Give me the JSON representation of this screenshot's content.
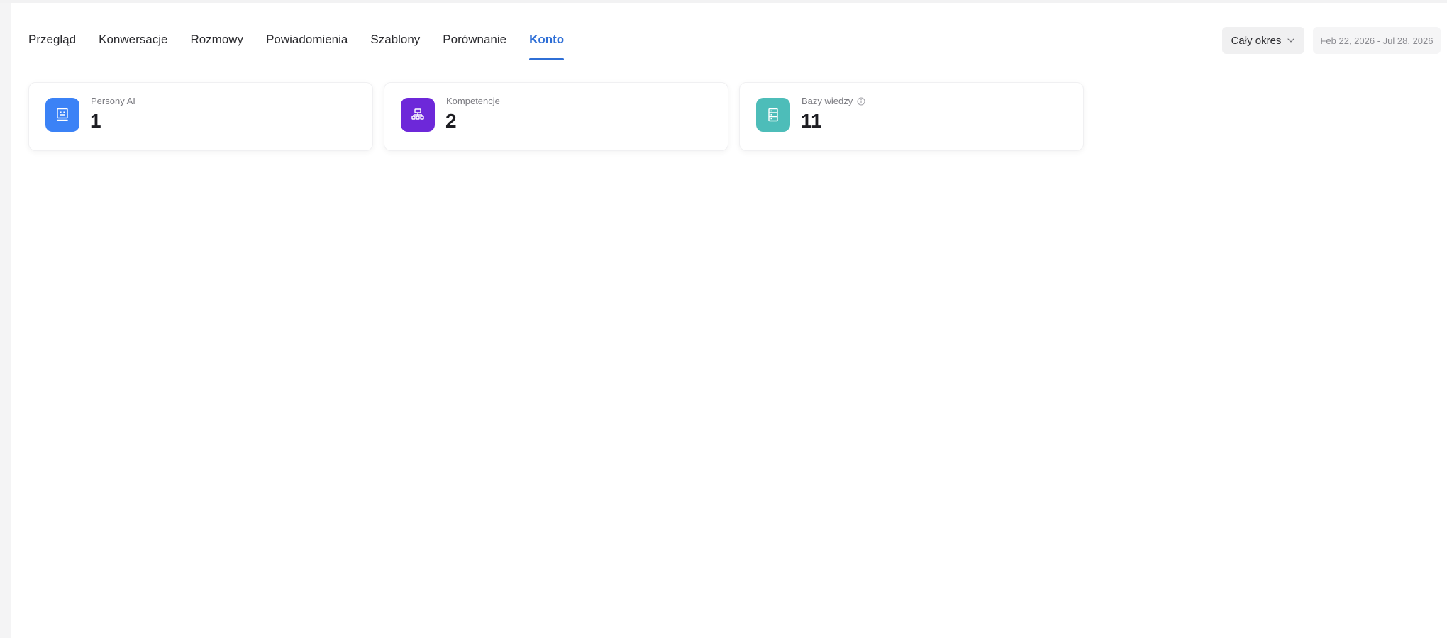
{
  "tabs": [
    {
      "label": "Przegląd",
      "active": false
    },
    {
      "label": "Konwersacje",
      "active": false
    },
    {
      "label": "Rozmowy",
      "active": false
    },
    {
      "label": "Powiadomienia",
      "active": false
    },
    {
      "label": "Szablony",
      "active": false
    },
    {
      "label": "Porównanie",
      "active": false
    },
    {
      "label": "Konto",
      "active": true
    }
  ],
  "controls": {
    "period_label": "Cały okres",
    "date_range": "Feb 22, 2026 - Jul 28, 2026"
  },
  "cards": [
    {
      "label": "Persony AI",
      "value": "1",
      "icon": "persona-icon",
      "color": "#3b82f6"
    },
    {
      "label": "Kompetencje",
      "value": "2",
      "icon": "hierarchy-icon",
      "color": "#6d28d9"
    },
    {
      "label": "Bazy wiedzy",
      "value": "11",
      "icon": "database-icon",
      "color": "#4dbdb9",
      "info_icon": "info-icon"
    }
  ],
  "colors": {
    "accent": "#2f6fd6",
    "text": "#2b2b2f",
    "muted": "#7a7a80"
  }
}
